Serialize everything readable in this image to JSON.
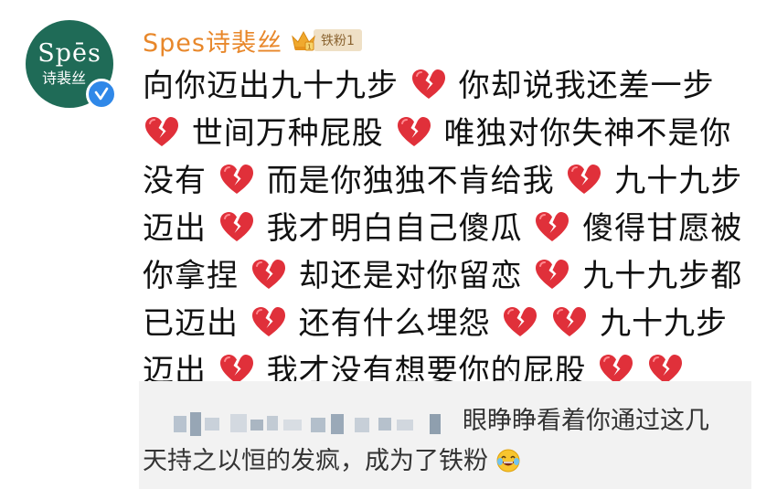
{
  "avatar": {
    "brand": "Spēs",
    "brand_cn": "诗裴丝"
  },
  "user": {
    "name": "Spes诗裴丝",
    "fan_badge": "铁粉1"
  },
  "post": {
    "segments": [
      "向你迈出九十九步",
      "你却说我还差一步",
      "世间万种屁股",
      "唯独对你失神不是你没有",
      "而是你独独不肯给我",
      "九十九步迈出",
      "我才明白自己傻瓜",
      "傻得甘愿被你拿捏",
      "却还是对你留恋",
      "九十九步都已迈出",
      "还有什么埋怨",
      "",
      "九十九步迈出",
      "我才没有想要你的屁股",
      ""
    ]
  },
  "comment": {
    "text": "眼睁睁看着你通过这几天持之以恒的发疯，成为了铁粉",
    "emoji": "laughing-tears-icon"
  },
  "colors": {
    "username": "#e8872a",
    "avatar_bg": "#1f6b57",
    "verified": "#2f88e8",
    "heart": "#e0303a"
  }
}
